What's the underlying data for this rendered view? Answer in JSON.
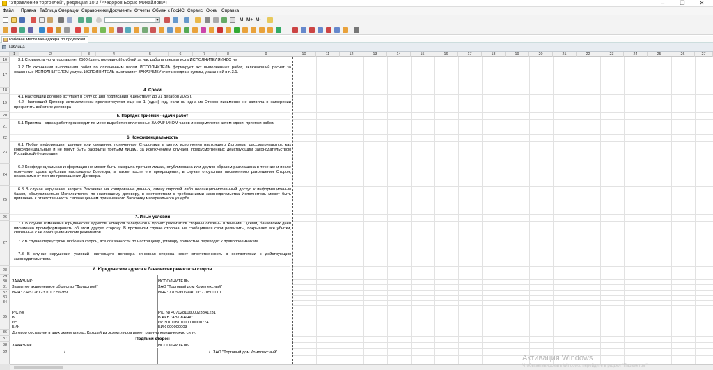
{
  "window": {
    "title": "\"Управление торговлей\", редакция 10.3 / Федоров Борис Михайлович",
    "min": "–",
    "max": "❐",
    "close": "✕"
  },
  "menu": [
    "Файл",
    "Правка",
    "Таблица",
    "Операции",
    "Справочники",
    "Документы",
    "Отчеты",
    "Обмен с ГосИС",
    "Сервис",
    "Окна",
    "Справка"
  ],
  "toolbar": {
    "m_label": "M",
    "mplus_label": "M+",
    "mminus_label": "M-"
  },
  "tab": {
    "label": "Рабочее место менеджера по продажам"
  },
  "doc_window": {
    "title": "Таблица"
  },
  "columns": [
    "1",
    "2",
    "3",
    "4",
    "5",
    "6",
    "7",
    "8",
    "9",
    "10",
    "11",
    "12",
    "13",
    "14",
    "15",
    "16",
    "17",
    "18",
    "19",
    "20",
    "21",
    "22",
    "23",
    "24",
    "25",
    "26",
    "27"
  ],
  "rows": [
    "16",
    "17",
    "18",
    "19",
    "20",
    "21",
    "22",
    "23",
    "24",
    "25",
    "26",
    "27",
    "28",
    "29",
    "30",
    "31",
    "32",
    "33",
    "34",
    "35",
    "36",
    "37",
    "38",
    "39"
  ],
  "content": {
    "p31": "3.1 Стоимость услуг составляет 2500 (две с половиной) рублей за час работы специалиста ИСПОЛНИТЕЛЯ (НДС не",
    "p32": "3.2 По окончании выполнения работ по оплаченным часам ИСПОЛНИТЕЛЬ формирует акт выполненных работ, включающий расчет за оказанные ИСПОЛНИТЕЛЕМ услуги. ИСПОЛНИТЕЛЬ выставляет ЗАКАЗЧИКУ счет исходя из суммы, указанной в п.3.1.",
    "h4": "4. Сроки",
    "p41": "4.1 Настоящий договор вступает в силу со дня подписания и действует до 31 декабря 2025 г.",
    "p42": "4.2 Настоящий Договор автоматически пролонгируется еще на 1 (один) год, если ни одна из Сторон письменно не заявила о намерении прекратить действие договора",
    "h5": "5. Порядок приёмки - сдачи работ",
    "p51": "5.1 Приемка - сдача работ происходит по мере выработки оплаченных ЗАКАЗЧИКОМ часов и оформляется актом сдачи- приемки работ.",
    "h6": "6. Конфиденциальность",
    "p61": "6.1 Любая информация, данные или сведения, полученные Сторонами в целях исполнения настоящего Договора, рассматриваются, как конфиденциальные и не могут быть раскрыты третьим лицам, за исключением случаев, предусмотренных действующим законодательством Российской Федерации.",
    "p62": "6.2 Конфиденциальная информация не может быть раскрыта третьим лицам, опубликована или другим образом разглашена в течение и после окончания срока действия настоящего Договора, а также после его прекращения, в случае отсутствия письменного разрешения Сторон, независимо от причин прекращения Договора.",
    "p63": "6.3 В случае нарушения запрета Заказчика на копирование данных, смену паролей либо несанкционированный доступ к информационным базам, обслуживаемым Исполнителем по настоящему договору, в соответствии с требованиями законодательства Исполнитель может быть привлечен к ответственности с возмещением причиненного Заказчику материального ущерба.",
    "h7": "7. Иные условия",
    "p71": "7.1 В случае изменения юридических адресов, номеров телефонов и прочих реквизитов стороны обязаны в течении 7 (семи) банковских дней письменно проинформировать об этом другую сторону. В противном случае сторона, не сообщившая свои реквизиты, покрывает все убытки, связанные с не сообщением своих реквизитов.",
    "p72": "7.2 В случае переуступки любой из сторон, все обязанности по настоящему Договору полностью переходят к правопреемникам.",
    "p73": "7.3 В случае нарушения условий настоящего договора виновная сторона несет ответственность в соответствии с действующим законодательством.",
    "h8": "8. Юридические адреса и банковские реквизиты сторон",
    "customer_label": "ЗАКАЗЧИК:",
    "customer_name": "Закрытое акционерное общество \"Дальстрой\"",
    "customer_inn": "ИНН: 2345126123 КПП: 56789",
    "customer_rs": "Р/С №",
    "customer_bank": "В",
    "customer_ks": "к/с",
    "customer_bik": "БИК",
    "executor_label": "ИСПОЛНИТЕЛЬ:",
    "executor_name": "ЗАО \"Торговый дом Комплексный\"",
    "executor_inn": "ИНН: 7705260699КПП: 770501001",
    "executor_rs": "Р/С № 40702810600023341231",
    "executor_bank": "В АКБ \"АВТ-БАНК\"",
    "executor_ks": "к/с 30101810100000000774",
    "executor_bik": "БИК 000000003",
    "copies_note": "Договор составлен в двух экземплярах. Каждый из экземпляров имеет равную юридическую силу.",
    "h_signatures": "Подписи сторон",
    "sign_customer": "ЗАКАЗЧИК",
    "sign_executor": "ИСПОЛНИТЕЛЬ",
    "sign_customer_slash": "/",
    "sign_executor_slash": "/",
    "sign_executor_name": "ЗАО \"Торговый дом Комплексный\""
  },
  "watermark": {
    "title": "Активация Windows",
    "subtitle": "Чтобы активировать Windows, перейдите в раздел \"Параметры\"."
  }
}
